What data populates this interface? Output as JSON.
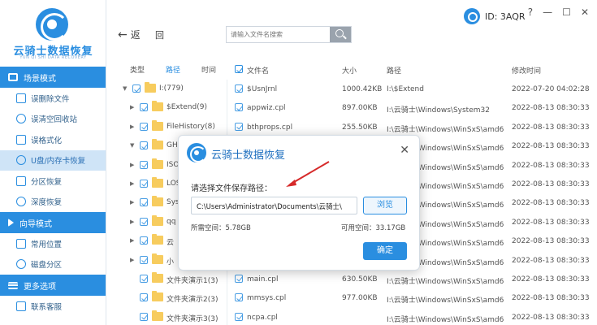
{
  "brand": {
    "title": "云骑士数据恢复",
    "subtitle": "YUN QI SHI DATA RECOVERY"
  },
  "header": {
    "back_label": "返",
    "return_label": "回",
    "search_placeholder": "请输入文件名搜索",
    "user_id": "ID: 3AQR",
    "window_buttons": [
      "?",
      "—",
      "☐"
    ]
  },
  "sidebar": {
    "scene_mode": "场景模式",
    "scene_items": [
      "误删除文件",
      "误清空回收站",
      "误格式化",
      "U盘/内存卡恢复",
      "分区恢复",
      "深度恢复"
    ],
    "active_index": 3,
    "wizard_mode": "向导模式",
    "wizard_items": [
      "常用位置",
      "磁盘分区"
    ],
    "more_options": "更多选项",
    "more_items": [
      "联系客服"
    ]
  },
  "tree": {
    "tabs": [
      "类型",
      "路径",
      "时间"
    ],
    "active_tab": 1,
    "rows": [
      {
        "toggle": "▼",
        "text": "I:(779)",
        "level": 0
      },
      {
        "toggle": "▶",
        "text": "$Extend(9)",
        "level": 1
      },
      {
        "toggle": "▶",
        "text": "FileHistory(8)",
        "level": 1
      },
      {
        "toggle": "▼",
        "text": "GHO",
        "level": 1
      },
      {
        "toggle": "▶",
        "text": "ISO",
        "level": 1
      },
      {
        "toggle": "▶",
        "text": "LOS",
        "level": 1
      },
      {
        "toggle": "▶",
        "text": "Syst",
        "level": 1
      },
      {
        "toggle": "▶",
        "text": "qq",
        "level": 1
      },
      {
        "toggle": "▶",
        "text": "云",
        "level": 1
      },
      {
        "toggle": "▶",
        "text": "小",
        "level": 1
      },
      {
        "toggle": "",
        "text": "文件夹演示1(3)",
        "level": 1
      },
      {
        "toggle": "",
        "text": "文件夹演示2(3)",
        "level": 1
      },
      {
        "toggle": "",
        "text": "文件夹演示3(3)",
        "level": 1
      }
    ]
  },
  "files": {
    "columns": [
      "文件名",
      "大小",
      "路径",
      "修改时间"
    ],
    "rows": [
      {
        "name": "$UsnJrnl",
        "size": "1000.42KB",
        "path": "I:\\$Extend",
        "time": "2022-07-20 04:02:28"
      },
      {
        "name": "appwiz.cpl",
        "size": "897.00KB",
        "path": "I:\\云骑士\\Windows\\System32",
        "time": "2022-08-13 08:30:33"
      },
      {
        "name": "bthprops.cpl",
        "size": "255.50KB",
        "path": "I:\\云骑士\\Windows\\WinSxS\\amd6...",
        "time": "2022-08-13 08:30:33"
      },
      {
        "name": "",
        "size": "",
        "path": "I:\\云骑士\\Windows\\WinSxS\\amd6...",
        "time": "2022-08-13 08:30:33"
      },
      {
        "name": "",
        "size": "",
        "path": "I:\\云骑士\\Windows\\WinSxS\\amd6...",
        "time": "2022-08-13 08:30:33"
      },
      {
        "name": "",
        "size": "",
        "path": "I:\\云骑士\\Windows\\WinSxS\\amd6...",
        "time": "2022-08-13 08:30:33"
      },
      {
        "name": "",
        "size": "",
        "path": "I:\\云骑士\\Windows\\WinSxS\\amd6...",
        "time": "2022-08-13 08:30:33"
      },
      {
        "name": "",
        "size": "",
        "path": "I:\\云骑士\\Windows\\WinSxS\\amd6...",
        "time": "2022-08-13 08:30:33"
      },
      {
        "name": "",
        "size": "",
        "path": "I:\\云骑士\\Windows\\WinSxS\\amd6...",
        "time": "2022-08-13 08:30:33"
      },
      {
        "name": "",
        "size": "",
        "path": "I:\\云骑士\\Windows\\WinSxS\\amd6...",
        "time": "2022-08-13 08:30:33"
      },
      {
        "name": "main.cpl",
        "size": "630.50KB",
        "path": "I:\\云骑士\\Windows\\WinSxS\\amd6...",
        "time": "2022-08-13 08:30:33"
      },
      {
        "name": "mmsys.cpl",
        "size": "977.00KB",
        "path": "I:\\云骑士\\Windows\\WinSxS\\amd6...",
        "time": "2022-08-13 08:30:33"
      },
      {
        "name": "ncpa.cpl",
        "size": "",
        "path": "I:\\云骑士\\Windows\\WinSxS\\amd6...",
        "time": "2022-08-13 08:30:33"
      }
    ]
  },
  "modal": {
    "title": "云骑士数据恢复",
    "close": "✕",
    "prompt": "请选择文件保存路径：",
    "path_value": "C:\\Users\\Administrator\\Documents\\云骑士\\",
    "browse": "浏览",
    "used_space": "所需空间：5.78GB",
    "free_space": "可用空间：33.17GB",
    "ok": "确定"
  },
  "colors": {
    "accent": "#2a8ee0",
    "folder": "#f6c342",
    "annotation_arrow": "#d62a2a"
  }
}
